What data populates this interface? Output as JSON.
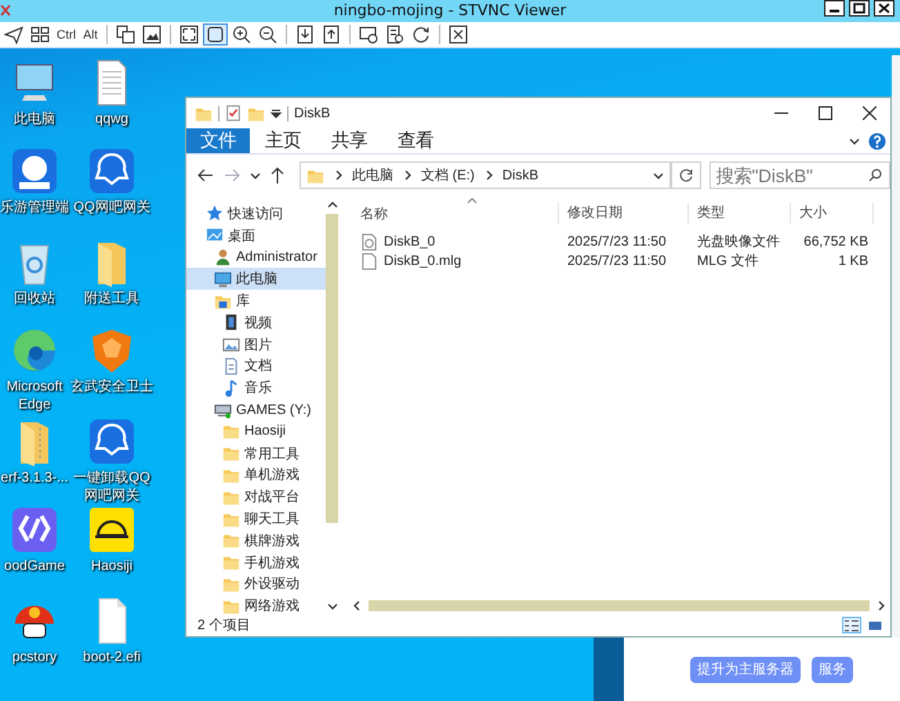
{
  "viewer": {
    "title": "ningbo-mojing - STVNC Viewer",
    "toolbar": [
      [
        {
          "kind": "icon",
          "selected": false
        },
        {
          "kind": "icon",
          "selected": false
        },
        {
          "kind": "text",
          "label": "Ctrl",
          "selected": false
        },
        {
          "kind": "text",
          "label": "Alt",
          "selected": false
        }
      ],
      [
        {
          "kind": "icon",
          "selected": false
        },
        {
          "kind": "icon",
          "selected": false
        }
      ],
      [
        {
          "kind": "icon",
          "selected": false
        },
        {
          "kind": "icon",
          "selected": true
        },
        {
          "kind": "icon",
          "selected": false
        },
        {
          "kind": "icon",
          "selected": false
        }
      ],
      [
        {
          "kind": "icon",
          "selected": false
        },
        {
          "kind": "icon",
          "selected": false
        }
      ],
      [
        {
          "kind": "icon",
          "selected": false
        },
        {
          "kind": "icon",
          "selected": false
        },
        {
          "kind": "icon",
          "selected": false
        }
      ],
      [
        {
          "kind": "icon",
          "selected": false
        }
      ]
    ]
  },
  "desktop": {
    "icons": [
      {
        "label": "此电脑"
      },
      {
        "label": "qqwg"
      },
      {
        "label": "乐游管理端"
      },
      {
        "label": "QQ网吧网关"
      },
      {
        "label": "回收站"
      },
      {
        "label": "附送工具"
      },
      {
        "label": "Microsoft Edge"
      },
      {
        "label": "玄武安全卫士"
      },
      {
        "label": "erf-3.1.3-..."
      },
      {
        "label": "一键卸载QQ网吧网关"
      },
      {
        "label": "oodGame"
      },
      {
        "label": "Haosiji"
      },
      {
        "label": "pcstory"
      },
      {
        "label": "boot-2.efi"
      }
    ]
  },
  "explorer": {
    "title": "DiskB",
    "ribbon_tabs": [
      {
        "label": "文件",
        "selected": true
      },
      {
        "label": "主页",
        "selected": false
      },
      {
        "label": "共享",
        "selected": false
      },
      {
        "label": "查看",
        "selected": false
      }
    ],
    "breadcrumb": [
      "此电脑",
      "文档 (E:)",
      "DiskB"
    ],
    "search": {
      "placeholder": "搜索\"DiskB\""
    },
    "nav": [
      {
        "label": "快速访问",
        "selected": false
      },
      {
        "label": "桌面",
        "selected": false,
        "children": [
          {
            "label": "Administrator",
            "selected": false
          },
          {
            "label": "此电脑",
            "selected": true
          },
          {
            "label": "库",
            "selected": false,
            "children": [
              {
                "label": "视频",
                "selected": false
              },
              {
                "label": "图片",
                "selected": false
              },
              {
                "label": "文档",
                "selected": false
              },
              {
                "label": "音乐",
                "selected": false
              }
            ]
          },
          {
            "label": "GAMES (Y:)",
            "selected": false,
            "children": [
              {
                "label": "Haosiji",
                "selected": false
              },
              {
                "label": "常用工具",
                "selected": false
              },
              {
                "label": "单机游戏",
                "selected": false
              },
              {
                "label": "对战平台",
                "selected": false
              },
              {
                "label": "聊天工具",
                "selected": false
              },
              {
                "label": "棋牌游戏",
                "selected": false
              },
              {
                "label": "手机游戏",
                "selected": false
              },
              {
                "label": "外设驱动",
                "selected": false
              },
              {
                "label": "网络游戏",
                "selected": false
              }
            ]
          }
        ]
      }
    ],
    "columns": [
      "名称",
      "修改日期",
      "类型",
      "大小"
    ],
    "files": [
      {
        "kind": "disc-image",
        "name": "DiskB_0",
        "modified": "2025/7/23 11:50",
        "type": "光盘映像文件",
        "size": "66,752 KB"
      },
      {
        "kind": "file",
        "name": "DiskB_0.mlg",
        "modified": "2025/7/23 11:50",
        "type": "MLG 文件",
        "size": "1 KB"
      }
    ],
    "status": "2 个项目",
    "view_buttons": [
      {
        "selected": true
      },
      {
        "selected": false
      }
    ]
  },
  "buttons": [
    "提升为主服务器",
    "服务"
  ]
}
